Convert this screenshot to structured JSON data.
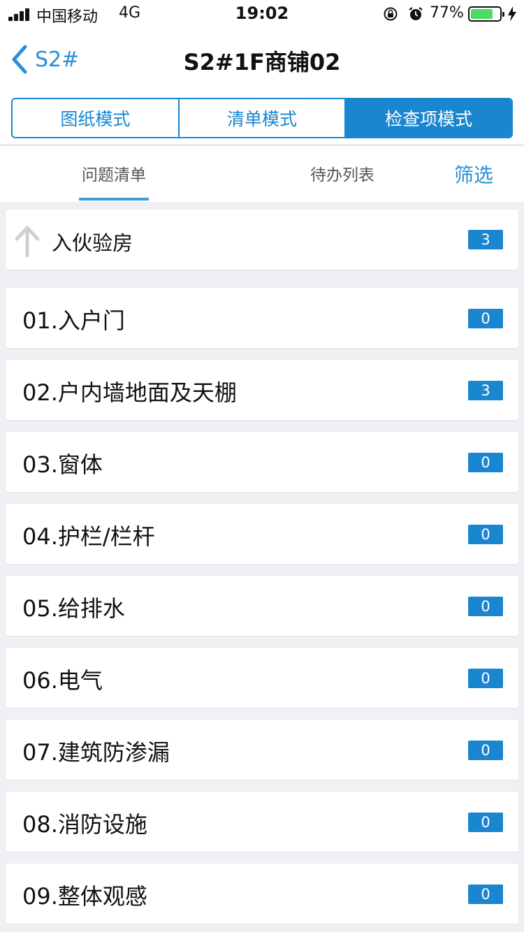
{
  "status_bar": {
    "carrier": "中国移动",
    "network": "4G",
    "time": "19:02",
    "battery_percent": "77%",
    "battery_level": 0.77,
    "icons": [
      "signal-icon",
      "orientation-lock-icon",
      "alarm-icon",
      "battery-icon",
      "charging-bolt-icon"
    ]
  },
  "nav": {
    "back_label": "S2#",
    "title": "S2#1F商铺02"
  },
  "segments": [
    {
      "label": "图纸模式",
      "active": false
    },
    {
      "label": "清单模式",
      "active": false
    },
    {
      "label": "检查项模式",
      "active": true
    }
  ],
  "tabs": {
    "issues": "问题清单",
    "todo": "待办列表",
    "filter": "筛选"
  },
  "parent": {
    "label": "入伙验房",
    "count": "3"
  },
  "items": [
    {
      "label": "01.入户门",
      "count": "0"
    },
    {
      "label": "02.户内墙地面及天棚",
      "count": "3"
    },
    {
      "label": "03.窗体",
      "count": "0"
    },
    {
      "label": "04.护栏/栏杆",
      "count": "0"
    },
    {
      "label": "05.给排水",
      "count": "0"
    },
    {
      "label": "06.电气",
      "count": "0"
    },
    {
      "label": "07.建筑防渗漏",
      "count": "0"
    },
    {
      "label": "08.消防设施",
      "count": "0"
    },
    {
      "label": "09.整体观感",
      "count": "0"
    }
  ],
  "colors": {
    "accent": "#1a86d0",
    "link": "#2a8fd6",
    "battery": "#4cd964",
    "background": "#efeff4"
  }
}
